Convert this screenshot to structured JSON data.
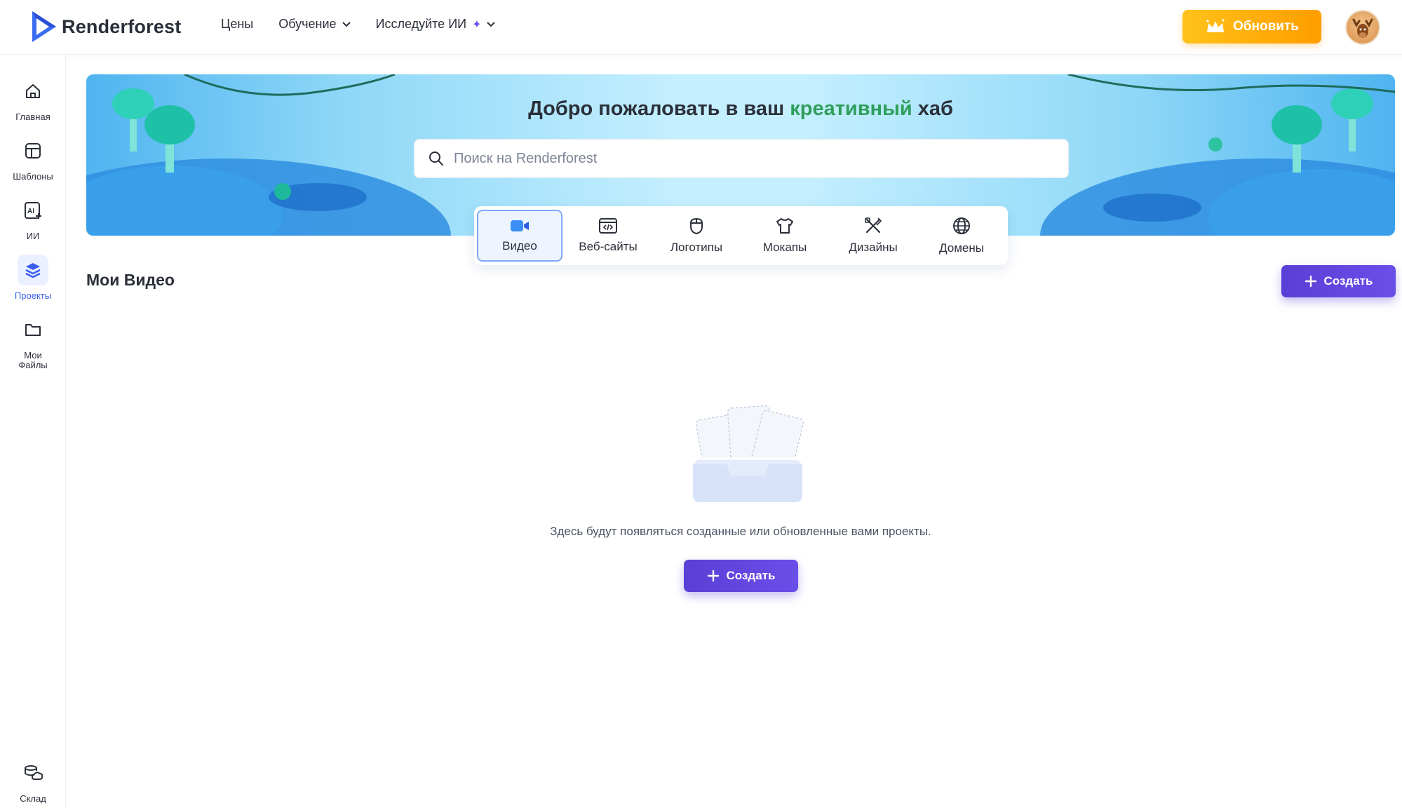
{
  "header": {
    "logo_text": "Renderforest",
    "nav": [
      {
        "label": "Цены"
      },
      {
        "label": "Обучение"
      },
      {
        "label": "Исследуйте ИИ"
      }
    ],
    "upgrade_label": "Обновить"
  },
  "sidebar": {
    "items": [
      {
        "label": "Главная",
        "icon": "home-icon"
      },
      {
        "label": "Шаблоны",
        "icon": "templates-icon"
      },
      {
        "label": "ИИ",
        "icon": "ai-icon"
      },
      {
        "label": "Проекты",
        "icon": "layers-icon",
        "active": true
      },
      {
        "label": "Мои Файлы",
        "icon": "folder-icon"
      }
    ],
    "bottom_item": {
      "label": "Склад",
      "icon": "storage-icon"
    }
  },
  "hero": {
    "title_before": "Добро пожаловать в ваш ",
    "title_highlight": "креативный",
    "title_after": " хаб",
    "search_placeholder": "Поиск на Renderforest"
  },
  "tabs": [
    {
      "label": "Видео",
      "icon": "video-icon",
      "active": true
    },
    {
      "label": "Веб-сайты",
      "icon": "website-icon"
    },
    {
      "label": "Логотипы",
      "icon": "logo-icon"
    },
    {
      "label": "Мокапы",
      "icon": "tshirt-icon"
    },
    {
      "label": "Дизайны",
      "icon": "design-icon"
    },
    {
      "label": "Домены",
      "icon": "globe-icon"
    }
  ],
  "main": {
    "section_title": "Мои Видео",
    "create_label": "Создать",
    "empty_text": "Здесь будут появляться созданные или обновленные вами проекты.",
    "empty_create_label": "Создать"
  },
  "colors": {
    "accent_purple": "#5a3fd6",
    "upgrade_orange": "#ffa800",
    "highlight_green": "#2f9e5a",
    "active_blue": "#3a5cf0"
  }
}
